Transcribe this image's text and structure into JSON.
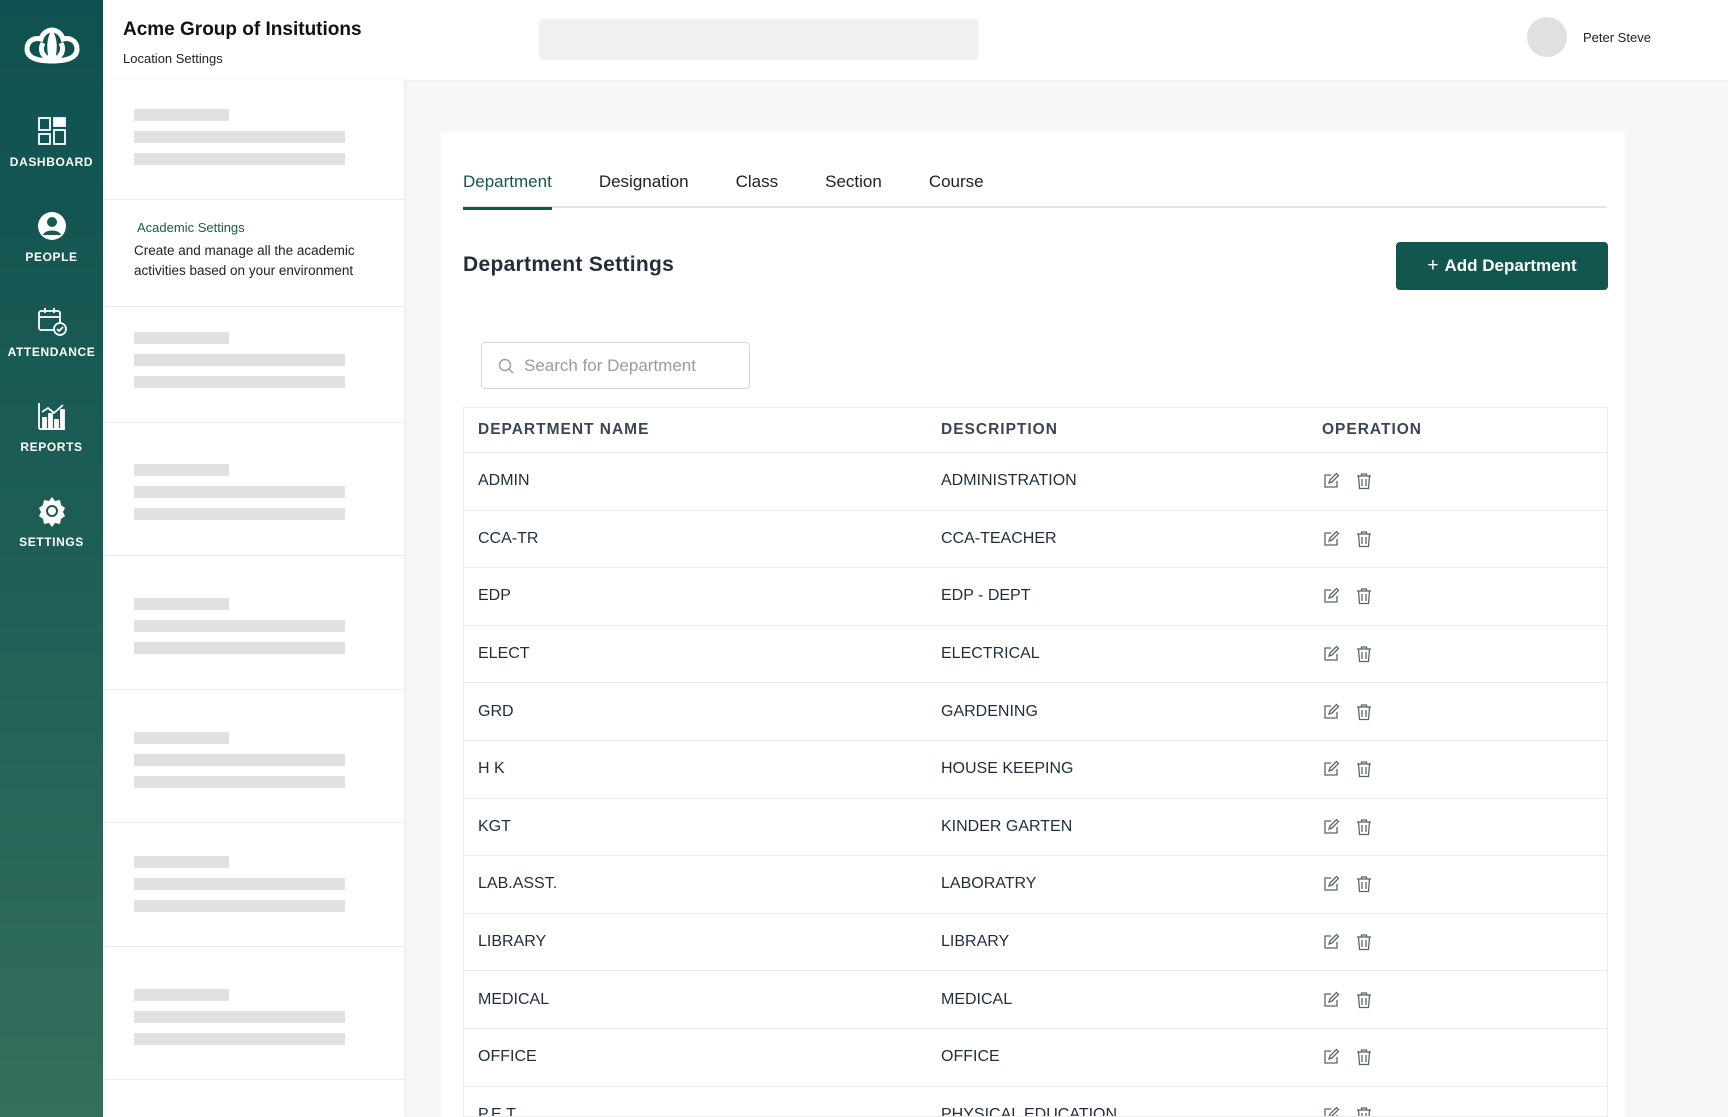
{
  "nav": {
    "logo": "logo-icon",
    "items": [
      {
        "label": "DASHBOARD",
        "icon": "dashboard-icon"
      },
      {
        "label": "PEOPLE",
        "icon": "person-icon"
      },
      {
        "label": "ATTENDANCE",
        "icon": "calendar-check-icon"
      },
      {
        "label": "REPORTS",
        "icon": "bar-chart-icon"
      },
      {
        "label": "SETTINGS",
        "icon": "gear-icon"
      }
    ]
  },
  "header": {
    "org_name": "Acme Group of Insitutions",
    "page_subtitle": "Location Settings",
    "user_name": "Peter Steve"
  },
  "settings_panel": {
    "active_title": "Academic Settings",
    "active_description": "Create and manage all the academic activities based on your environment"
  },
  "tabs": [
    "Department",
    "Designation",
    "Class",
    "Section",
    "Course"
  ],
  "active_tab": "Department",
  "main": {
    "title": "Department Settings",
    "add_button_label": "Add Department",
    "search_placeholder": "Search for Department"
  },
  "table": {
    "headers": [
      "DEPARTMENT NAME",
      "DESCRIPTION",
      "OPERATION"
    ],
    "rows": [
      {
        "name": "ADMIN",
        "description": "ADMINISTRATION"
      },
      {
        "name": "CCA-TR",
        "description": "CCA-TEACHER"
      },
      {
        "name": "EDP",
        "description": "EDP - DEPT"
      },
      {
        "name": "ELECT",
        "description": "ELECTRICAL"
      },
      {
        "name": "GRD",
        "description": "GARDENING"
      },
      {
        "name": "H K",
        "description": "HOUSE KEEPING"
      },
      {
        "name": "KGT",
        "description": "KINDER GARTEN"
      },
      {
        "name": "LAB.ASST.",
        "description": "LABORATRY"
      },
      {
        "name": "LIBRARY",
        "description": "LIBRARY"
      },
      {
        "name": "MEDICAL",
        "description": "MEDICAL"
      },
      {
        "name": "OFFICE",
        "description": "OFFICE"
      },
      {
        "name": "P.E.T",
        "description": "PHYSICAL EDUCATION"
      }
    ],
    "operation_icons": [
      "edit-icon",
      "trash-icon"
    ]
  },
  "colors": {
    "brand": "#11564f",
    "rail_top": "#0f5150",
    "rail_bottom": "#336f5c",
    "skeleton": "#e0e0e0"
  }
}
